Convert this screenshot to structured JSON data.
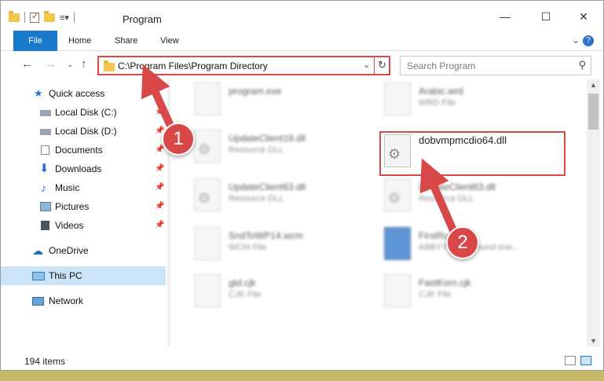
{
  "window": {
    "title": "Program"
  },
  "ribbon": {
    "tabs": [
      "File",
      "Home",
      "Share",
      "View"
    ]
  },
  "address": {
    "path": "C:\\Program Files\\Program Directory"
  },
  "search": {
    "placeholder": "Search Program"
  },
  "sidebar": {
    "items": [
      {
        "label": "Quick access",
        "icon": "star-icon",
        "pinned": false
      },
      {
        "label": "Local Disk (C:)",
        "icon": "drive-icon",
        "pinned": true
      },
      {
        "label": "Local Disk (D:)",
        "icon": "drive-icon",
        "pinned": true
      },
      {
        "label": "Documents",
        "icon": "documents-icon",
        "pinned": true
      },
      {
        "label": "Downloads",
        "icon": "downloads-icon",
        "pinned": true
      },
      {
        "label": "Music",
        "icon": "music-icon",
        "pinned": true
      },
      {
        "label": "Pictures",
        "icon": "pictures-icon",
        "pinned": true
      },
      {
        "label": "Videos",
        "icon": "videos-icon",
        "pinned": true
      },
      {
        "label": "OneDrive",
        "icon": "cloud-icon",
        "pinned": false
      },
      {
        "label": "This PC",
        "icon": "computer-icon",
        "pinned": false,
        "selected": true
      },
      {
        "label": "Network",
        "icon": "network-icon",
        "pinned": false
      }
    ]
  },
  "files": [
    {
      "name": "program.exe",
      "type": ""
    },
    {
      "name": "Arabic.wrd",
      "type": "WRD File"
    },
    {
      "name": "UpdateClient19.dll",
      "type": "Resource DLL"
    },
    {
      "name": "dobvmpmcdio64.dll",
      "type": ""
    },
    {
      "name": "UpdateClient63.dll",
      "type": "Resource DLL"
    },
    {
      "name": "UpdateClient63.dll",
      "type": "Resource DLL"
    },
    {
      "name": "SndToWP14.wcm",
      "type": "WCM File"
    },
    {
      "name": "FirstRun.exe",
      "type": "ABBYY Background exe..."
    },
    {
      "name": "gtd.cjk",
      "type": "CJK File"
    },
    {
      "name": "FastKorn.cjk",
      "type": "CJK File"
    }
  ],
  "status": {
    "item_count": "194 items"
  },
  "annotations": {
    "step1": "1",
    "step2": "2"
  },
  "colors": {
    "highlight": "#d64a4a",
    "accent": "#1979ca",
    "selected": "#cce4f7"
  }
}
